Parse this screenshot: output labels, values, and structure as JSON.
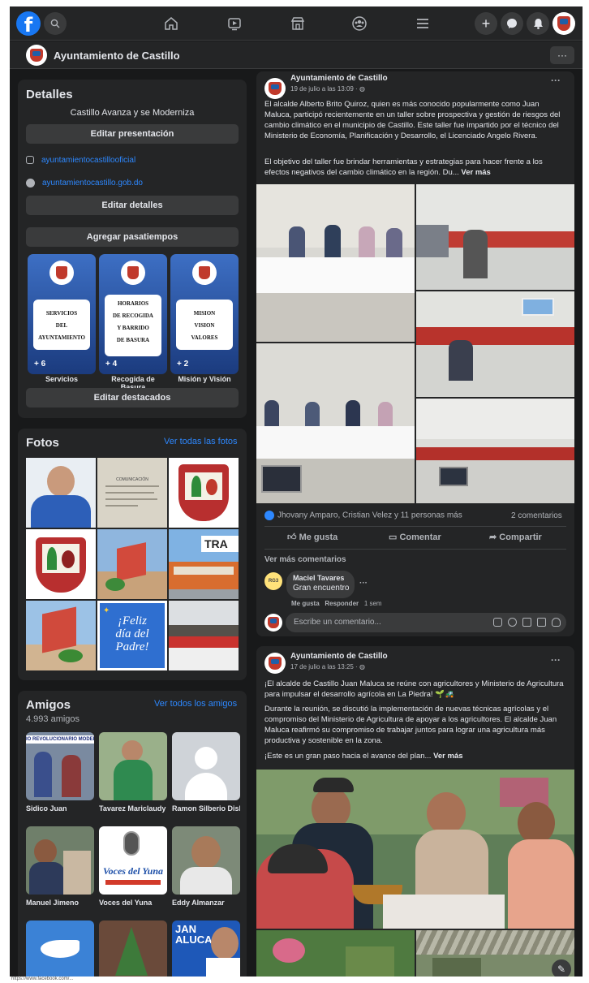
{
  "topnav": {
    "logo_glyph": "f",
    "icons": [
      "search-icon",
      "home-icon",
      "video-icon",
      "marketplace-icon",
      "groups-icon",
      "menu-icon",
      "plus-icon",
      "messenger-icon",
      "bell-icon",
      "profile-avatar"
    ]
  },
  "page": {
    "name": "Ayuntamiento de Castillo",
    "more_label": "···"
  },
  "details": {
    "title": "Detalles",
    "bio": "Castillo Avanza y se Moderniza",
    "edit_intro": "Editar presentación",
    "instagram": "ayuntamientocastillooficial",
    "website": "ayuntamientocastillo.gob.do",
    "edit_details": "Editar detalles",
    "add_hobbies": "Agregar pasatiempos",
    "featured": [
      {
        "lines": [
          "SERVICIOS",
          "DEL",
          "AYUNTAMIENTO"
        ],
        "count": "+ 6",
        "label": "Servicios"
      },
      {
        "lines": [
          "HORARIOS",
          "DE RECOGIDA",
          "Y BARRIDO",
          "DE BASURA"
        ],
        "count": "+ 4",
        "label": "Recogida de Basura"
      },
      {
        "lines": [
          "MISION",
          "VISION",
          "VALORES"
        ],
        "count": "+ 2",
        "label": "Misión y Visión"
      }
    ],
    "edit_featured": "Editar destacados"
  },
  "photos": {
    "title": "Fotos",
    "see_all": "Ver todas las fotos",
    "tile_text": [
      "¡Feliz",
      "día del",
      "Padre!"
    ],
    "doc_caption": "COMUNICACIÓN",
    "banner": "TRA"
  },
  "friends": {
    "title": "Amigos",
    "see_all": "Ver todos los amigos",
    "count": "4.993 amigos",
    "list": [
      {
        "name": "Sidico Juan",
        "thumb_text": "IO REVOLUCIONARIO MODER"
      },
      {
        "name": "Tavarez Mariclaudy",
        "thumb_text": ""
      },
      {
        "name": "Ramon Silberio Disla",
        "thumb_text": ""
      },
      {
        "name": "Manuel Jimeno",
        "thumb_text": ""
      },
      {
        "name": "Voces del Yuna",
        "thumb_text": "Voces del Yuna"
      },
      {
        "name": "Eddy Almanzar",
        "thumb_text": ""
      },
      {
        "name": "",
        "thumb_text": ""
      },
      {
        "name": "",
        "thumb_text": ""
      },
      {
        "name": "",
        "thumb_text": "JAN ALUCA"
      }
    ]
  },
  "post1": {
    "author": "Ayuntamiento de Castillo",
    "time": "19 de julio a las 13:09 · ◍",
    "para1": "El alcalde Alberto Brito Quiroz, quien es más conocido popularmente como Juan Maluca, participó recientemente en un taller sobre prospectiva y gestión de riesgos del cambio climático en el municipio de Castillo. Este taller fue impartido por el técnico del Ministerio de Economía, Planificación y Desarrollo, el Licenciado Angelo Rivera.",
    "para2": "El objetivo del taller fue brindar herramientas y estrategias para hacer frente a los efectos negativos del cambio climático en la región. Du...",
    "see_more": "Ver más",
    "reactions": "Jhovany Amparo, Cristian Velez y 11 personas más",
    "comments_count": "2 comentarios",
    "like": "Me gusta",
    "comment": "Comentar",
    "share": "Compartir",
    "more_comments": "Ver más comentarios",
    "comment_author": "Maciel Tavares",
    "comment_text": "Gran encuentro",
    "comment_like": "Me gusta",
    "comment_reply": "Responder",
    "comment_time": "1 sem",
    "write_placeholder": "Escribe un comentario...",
    "commenter_badge": "RG3"
  },
  "post2": {
    "author": "Ayuntamiento de Castillo",
    "time": "17 de julio a las 13:25 · ◍",
    "para1": "¡El alcalde de Castillo Juan Maluca se reúne con agricultores y Ministerio de Agricultura para impulsar el desarrollo agrícola en La Piedra! 🌱🚜",
    "para2": "Durante la reunión, se discutió la implementación de nuevas técnicas agrícolas y el compromiso del Ministerio de Agricultura de apoyar a los agricultores. El alcalde Juan Maluca reafirmó su compromiso de trabajar juntos para lograr una agricultura más productiva y sostenible en la zona.",
    "para3": "¡Este es un gran paso hacia el avance del plan...",
    "see_more": "Ver más"
  },
  "status_url": "https://www.facebook.com/..."
}
